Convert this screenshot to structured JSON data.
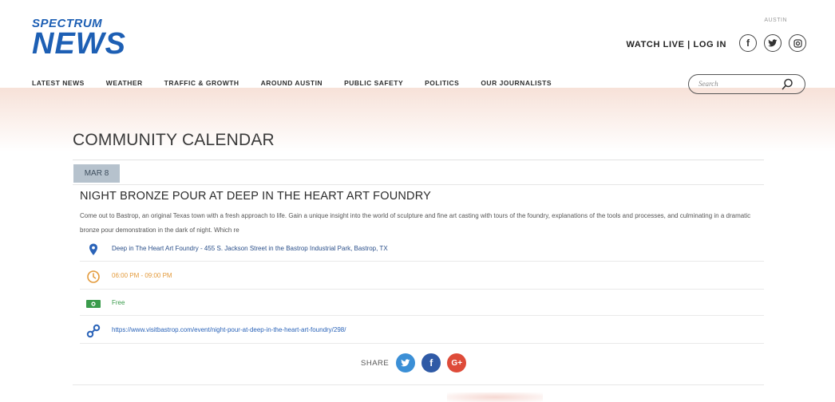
{
  "header": {
    "logo_line1": "SPECTRUM",
    "logo_line2": "NEWS",
    "region": "AUSTIN",
    "watch_login": "WATCH LIVE | LOG IN",
    "social_icons": [
      "facebook-icon",
      "twitter-icon",
      "instagram-icon"
    ]
  },
  "nav": {
    "items": [
      "LATEST NEWS",
      "WEATHER",
      "TRAFFIC & GROWTH",
      "AROUND AUSTIN",
      "PUBLIC SAFETY",
      "POLITICS",
      "OUR JOURNALISTS"
    ]
  },
  "search": {
    "placeholder": "Search"
  },
  "calendar": {
    "title": "COMMUNITY CALENDAR",
    "event": {
      "date": "MAR 8",
      "title": "NIGHT BRONZE POUR AT DEEP IN THE HEART ART FOUNDRY",
      "description": "Come out to Bastrop, an original Texas town with a fresh approach to life. Gain a unique insight into the world of sculpture and fine art casting with tours of the foundry, explanations of the tools and processes, and culminating in a dramatic bronze pour demonstration in the dark of night. Which re",
      "location": "Deep in The Heart Art Foundry - 455 S. Jackson Street in the Bastrop Industrial Park, Bastrop, TX",
      "time": "06:00 PM - 09:00 PM",
      "price": "Free",
      "url": "https://www.visitbastrop.com/event/night-pour-at-deep-in-the-heart-art-foundry/298/"
    },
    "share_label": "SHARE"
  },
  "colors": {
    "brand_blue": "#1d5fb4",
    "date_badge": "#b6c2cd",
    "location_icon": "#2a63b8",
    "time": "#e39a3b",
    "price": "#3a9b4b",
    "link": "#2a63b8",
    "twitter": "#3b8fd6",
    "facebook": "#2f5aa6",
    "google_plus": "#de4b39"
  }
}
